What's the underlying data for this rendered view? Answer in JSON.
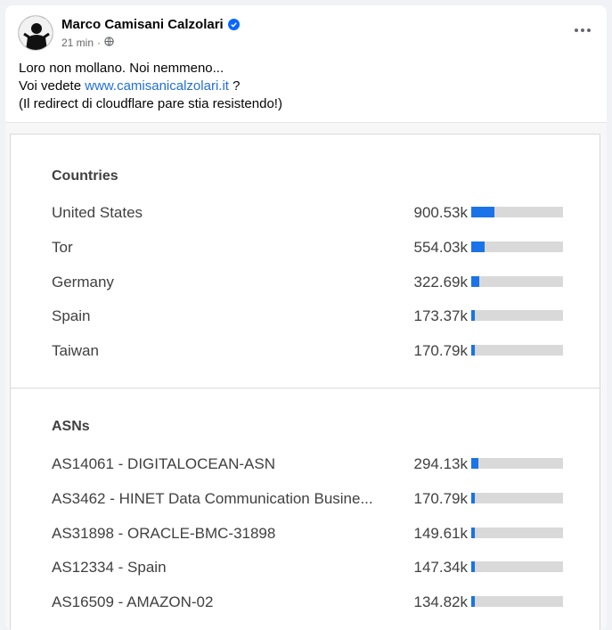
{
  "post": {
    "author": "Marco Camisani Calzolari",
    "time": "21 min",
    "separator": "·",
    "line1": "Loro non mollano. Noi nemmeno...",
    "line2_prefix": "Voi vedete ",
    "link": "www.camisanicalzolari.it",
    "line2_suffix": " ?",
    "line3": "(Il redirect di cloudflare pare stia resistendo!)"
  },
  "icons": {
    "verified": "verified-badge-icon",
    "audience": "globe-icon",
    "more": "more-options-icon",
    "avatar": "profile-avatar"
  },
  "colors": {
    "bar": "#1a73e8",
    "track": "#d9d9d9",
    "link": "#216fdb",
    "verified": "#0866ff"
  },
  "countries": {
    "title": "Countries",
    "rows": [
      {
        "label": "United States",
        "value": "900.53k",
        "fraction": 0.25
      },
      {
        "label": "Tor",
        "value": "554.03k",
        "fraction": 0.15
      },
      {
        "label": "Germany",
        "value": "322.69k",
        "fraction": 0.09
      },
      {
        "label": "Spain",
        "value": "173.37k",
        "fraction": 0.04
      },
      {
        "label": "Taiwan",
        "value": "170.79k",
        "fraction": 0.04
      }
    ]
  },
  "asns": {
    "title": "ASNs",
    "rows": [
      {
        "label": "AS14061 - DIGITALOCEAN-ASN",
        "value": "294.13k",
        "fraction": 0.08
      },
      {
        "label": "AS3462 - HINET Data Communication Busine...",
        "value": "170.79k",
        "fraction": 0.04
      },
      {
        "label": "AS31898 - ORACLE-BMC-31898",
        "value": "149.61k",
        "fraction": 0.04
      },
      {
        "label": "AS12334 - Spain",
        "value": "147.34k",
        "fraction": 0.04
      },
      {
        "label": "AS16509 - AMAZON-02",
        "value": "134.82k",
        "fraction": 0.04
      }
    ]
  }
}
